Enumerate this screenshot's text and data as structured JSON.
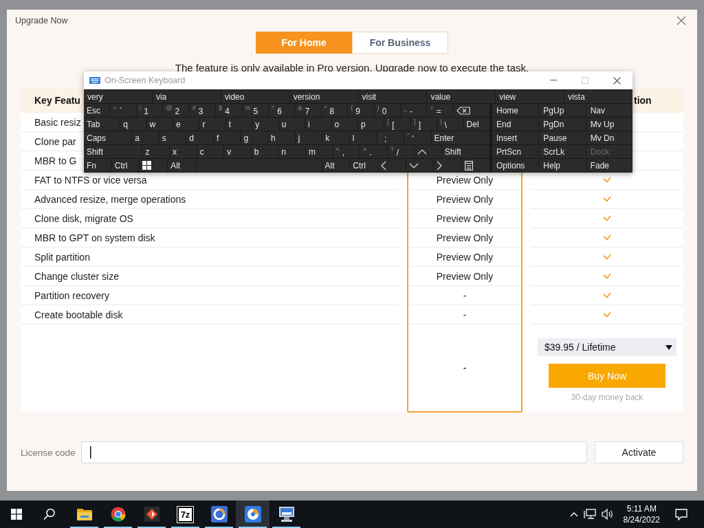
{
  "dialog": {
    "title": "Upgrade Now",
    "tabs": [
      {
        "label": "For Home",
        "selected": true
      },
      {
        "label": "For Business",
        "selected": false
      }
    ],
    "notice": "The feature is only available in Pro version. Upgrade now to execute the task.",
    "table": {
      "column_1": "Key Featu",
      "column_3": "tion",
      "rows": [
        {
          "feature": "Basic resiz"
        },
        {
          "feature": "Clone par"
        },
        {
          "feature": "MBR to G"
        },
        {
          "feature": "FAT to NTFS or vice versa",
          "free": "Preview Only",
          "pro": true
        },
        {
          "feature": "Advanced resize, merge operations",
          "free": "Preview Only",
          "pro": true
        },
        {
          "feature": "Clone disk, migrate OS",
          "free": "Preview Only",
          "pro": true
        },
        {
          "feature": "MBR to GPT on system disk",
          "free": "Preview Only",
          "pro": true
        },
        {
          "feature": "Split partition",
          "free": "Preview Only",
          "pro": true
        },
        {
          "feature": "Change cluster size",
          "free": "Preview Only",
          "pro": true
        },
        {
          "feature": "Partition recovery",
          "free": "-",
          "pro": true
        },
        {
          "feature": "Create bootable disk",
          "free": "-",
          "pro": true
        }
      ],
      "purchase": {
        "free": "-",
        "price": "$39.95 / Lifetime",
        "buy": "Buy Now",
        "note": "30-day money back"
      }
    },
    "license": {
      "label": "License code",
      "button": "Activate"
    }
  },
  "keyboard": {
    "title": "On-Screen Keyboard",
    "suggestions": [
      "very",
      "via",
      "video",
      "version",
      "visit",
      "value",
      "view",
      "vista"
    ],
    "rows": [
      [
        {
          "main": "Esc",
          "kind": "normal"
        },
        {
          "shift": "~",
          "main": "`",
          "kind": "normal"
        },
        {
          "shift": "!",
          "main": "1",
          "kind": "normal"
        },
        {
          "shift": "@",
          "main": "2",
          "kind": "normal"
        },
        {
          "shift": "#",
          "main": "3",
          "kind": "normal"
        },
        {
          "shift": "$",
          "main": "4",
          "kind": "normal"
        },
        {
          "shift": "%",
          "main": "5",
          "kind": "normal"
        },
        {
          "shift": "^",
          "main": "6",
          "kind": "normal"
        },
        {
          "shift": "&",
          "main": "7",
          "kind": "normal"
        },
        {
          "shift": "*",
          "main": "8",
          "kind": "normal"
        },
        {
          "shift": "(",
          "main": "9",
          "kind": "normal"
        },
        {
          "shift": ")",
          "main": "0",
          "kind": "normal"
        },
        {
          "shift": "_",
          "main": "-",
          "kind": "normal"
        },
        {
          "shift": "+",
          "main": "=",
          "kind": "normal"
        },
        {
          "kind": "wide"
        }
      ],
      [
        {
          "main": "Tab",
          "kind": "wide"
        },
        {
          "main": "q",
          "kind": "normal"
        },
        {
          "main": "w",
          "kind": "normal"
        },
        {
          "main": "e",
          "kind": "normal"
        },
        {
          "main": "r",
          "kind": "normal"
        },
        {
          "main": "t",
          "kind": "normal"
        },
        {
          "main": "y",
          "kind": "normal"
        },
        {
          "main": "u",
          "kind": "normal"
        },
        {
          "main": "i",
          "kind": "normal"
        },
        {
          "main": "o",
          "kind": "normal"
        },
        {
          "main": "p",
          "kind": "normal"
        },
        {
          "shift": "{",
          "main": "[",
          "kind": "normal"
        },
        {
          "shift": "}",
          "main": "]",
          "kind": "normal"
        },
        {
          "shift": "|",
          "main": "\\",
          "kind": "normal"
        },
        {
          "main": "Del",
          "kind": "normal"
        }
      ],
      [
        {
          "main": "Caps",
          "kind": "wider"
        },
        {
          "main": "a",
          "kind": "normal"
        },
        {
          "main": "s",
          "kind": "normal"
        },
        {
          "main": "d",
          "kind": "normal"
        },
        {
          "main": "f",
          "kind": "normal"
        },
        {
          "main": "g",
          "kind": "normal"
        },
        {
          "main": "h",
          "kind": "normal"
        },
        {
          "main": "j",
          "kind": "normal"
        },
        {
          "main": "k",
          "kind": "normal"
        },
        {
          "main": "l",
          "kind": "normal"
        },
        {
          "shift": ":",
          "main": ";",
          "kind": "normal"
        },
        {
          "shift": "\"",
          "main": "'",
          "kind": "normal"
        },
        {
          "main": "Enter",
          "kind": "widest"
        }
      ],
      [
        {
          "main": "Shift",
          "kind": "widest"
        },
        {
          "main": "z",
          "kind": "normal"
        },
        {
          "main": "x",
          "kind": "normal"
        },
        {
          "main": "c",
          "kind": "normal"
        },
        {
          "main": "v",
          "kind": "normal"
        },
        {
          "main": "b",
          "kind": "normal"
        },
        {
          "main": "n",
          "kind": "normal"
        },
        {
          "main": "m",
          "kind": "normal"
        },
        {
          "shift": "<",
          "main": ",",
          "kind": "normal"
        },
        {
          "shift": ">",
          "main": ".",
          "kind": "normal"
        },
        {
          "shift": "?",
          "main": "/",
          "kind": "normal"
        },
        {
          "kind": "normal"
        },
        {
          "main": "Shift",
          "kind": "wider"
        }
      ],
      [
        {
          "main": "Fn",
          "kind": "normal"
        },
        {
          "main": "Ctrl",
          "kind": "normal"
        },
        {
          "kind": "normal"
        },
        {
          "main": "Alt",
          "kind": "normal"
        },
        {
          "kind": "space"
        },
        {
          "main": "Alt",
          "kind": "normal"
        },
        {
          "main": "Ctrl",
          "kind": "normal"
        },
        {
          "kind": "normal"
        },
        {
          "kind": "normal"
        },
        {
          "kind": "normal"
        },
        {
          "kind": "normal"
        }
      ]
    ],
    "nav": [
      {
        "label": "Home",
        "disabled": false
      },
      {
        "label": "PgUp",
        "disabled": false
      },
      {
        "label": "Nav",
        "disabled": false
      },
      {
        "label": "End",
        "disabled": false
      },
      {
        "label": "PgDn",
        "disabled": false
      },
      {
        "label": "Mv Up",
        "disabled": false
      },
      {
        "label": "Insert",
        "disabled": false
      },
      {
        "label": "Pause",
        "disabled": false
      },
      {
        "label": "Mv Dn",
        "disabled": false
      },
      {
        "label": "PrtScn",
        "disabled": false
      },
      {
        "label": "ScrLk",
        "disabled": false
      },
      {
        "label": "Dock",
        "disabled": true
      },
      {
        "label": "Options",
        "disabled": false
      },
      {
        "label": "Help",
        "disabled": false
      },
      {
        "label": "Fade",
        "disabled": false
      }
    ]
  },
  "taskbar": {
    "apps": [
      {
        "selected": false,
        "running": true
      },
      {
        "selected": false,
        "running": true
      },
      {
        "selected": false,
        "running": true
      },
      {
        "label": "7z",
        "selected": false,
        "running": true
      },
      {
        "selected": false,
        "running": true
      },
      {
        "selected": true,
        "running": true
      },
      {
        "selected": false,
        "running": true
      }
    ],
    "time": "5:11 AM",
    "date": "8/24/2022"
  }
}
